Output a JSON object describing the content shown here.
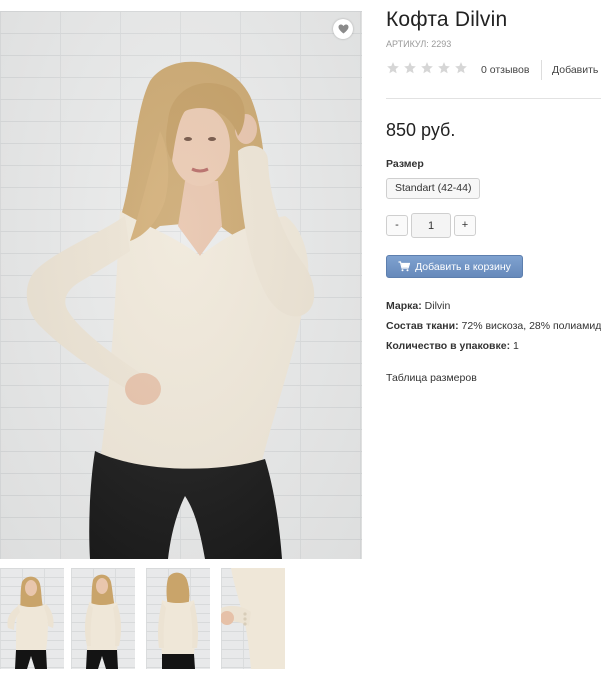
{
  "product": {
    "title": "Кофта Dilvin",
    "sku": "АРТИКУЛ: 2293",
    "rating": {
      "value": 0,
      "max": 5
    },
    "reviews_label": "0 отзывов",
    "add_review_label": "Добавить",
    "price": "850 руб.",
    "size_heading": "Размер",
    "size_option": "Standart (42-44)",
    "quantity": {
      "minus": "-",
      "value": "1",
      "plus": "+"
    },
    "add_to_cart_label": "Добавить в корзину",
    "attributes": [
      {
        "label": "Марка:",
        "value": "Dilvin"
      },
      {
        "label": "Состав ткани:",
        "value": "72% вискоза, 28% полиамид"
      },
      {
        "label": "Количество в упаковке:",
        "value": "1"
      }
    ],
    "size_table_link": "Таблица размеров"
  },
  "colors": {
    "star_empty": "#d6d6d6",
    "cart_button": "#6f92c4",
    "sweater": "#efe7d8",
    "pants": "#141414",
    "hair": "#c9a46a",
    "skin": "#e6c1a8"
  },
  "icons": {
    "favorite": "heart-icon",
    "cart": "cart-icon",
    "rating": "star-icon"
  }
}
